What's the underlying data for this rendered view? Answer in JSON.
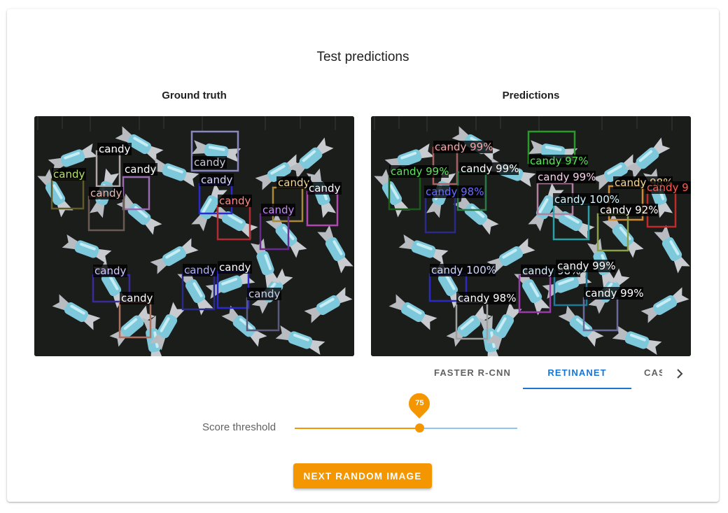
{
  "page": {
    "title": "Test predictions"
  },
  "ground_truth": {
    "heading": "Ground truth",
    "labels": [
      {
        "text": "candy",
        "color": "#ffffff"
      },
      {
        "text": "candy",
        "color": "#b5e06a"
      },
      {
        "text": "candy",
        "color": "#ffffff"
      },
      {
        "text": "candy",
        "color": "#e8b7b0"
      },
      {
        "text": "candy",
        "color": "#c8c8d8"
      },
      {
        "text": "candy",
        "color": "#d8d8ff"
      },
      {
        "text": "candy",
        "color": "#ff8a80"
      },
      {
        "text": "candy",
        "color": "#f3d79a"
      },
      {
        "text": "candy",
        "color": "#ffffff"
      },
      {
        "text": "candy",
        "color": "#c58af9"
      },
      {
        "text": "candy",
        "color": "#d0c8ff"
      },
      {
        "text": "candy",
        "color": "#ffffff"
      },
      {
        "text": "candy",
        "color": "#b0b0ff"
      },
      {
        "text": "candy",
        "color": "#ffffff"
      },
      {
        "text": "candy",
        "color": "#d0d0e8"
      }
    ]
  },
  "predictions": {
    "heading": "Predictions",
    "labels": [
      {
        "text": "candy 99%",
        "color": "#f0a8a8"
      },
      {
        "text": "candy 97%",
        "color": "#5de15d"
      },
      {
        "text": "candy 99%",
        "color": "#5de15d"
      },
      {
        "text": "candy 99%",
        "color": "#ffffff"
      },
      {
        "text": "candy 99%",
        "color": "#f6d0e8"
      },
      {
        "text": "candy 98%",
        "color": "#f3d79a"
      },
      {
        "text": "candy 9",
        "color": "#ff5a50"
      },
      {
        "text": "candy 98%",
        "color": "#6a6aff"
      },
      {
        "text": "candy 100%",
        "color": "#d0f6ff"
      },
      {
        "text": "candy 92%",
        "color": "#ffffff"
      },
      {
        "text": "candy 100%",
        "color": "#d0d8ff"
      },
      {
        "text": "candy 98%",
        "color": "#d8f0ff"
      },
      {
        "text": "candy 99%",
        "color": "#ffffff"
      },
      {
        "text": "candy 98%",
        "color": "#ffffff"
      },
      {
        "text": "candy 99%",
        "color": "#ffffff"
      }
    ]
  },
  "model_tabs": {
    "items": [
      "FASTER R-CNN",
      "RETINANET",
      "CAS"
    ],
    "selected": "RETINANET",
    "next_icon": "chevron-right-icon"
  },
  "score_threshold": {
    "label": "Score threshold",
    "value": 75,
    "value_label": "75",
    "min": 0,
    "max": 100,
    "fill_color": "#f39600",
    "track_color": "#8fc6ef"
  },
  "actions": {
    "next_image_label": "NEXT RANDOM IMAGE",
    "color": "#f39600"
  }
}
